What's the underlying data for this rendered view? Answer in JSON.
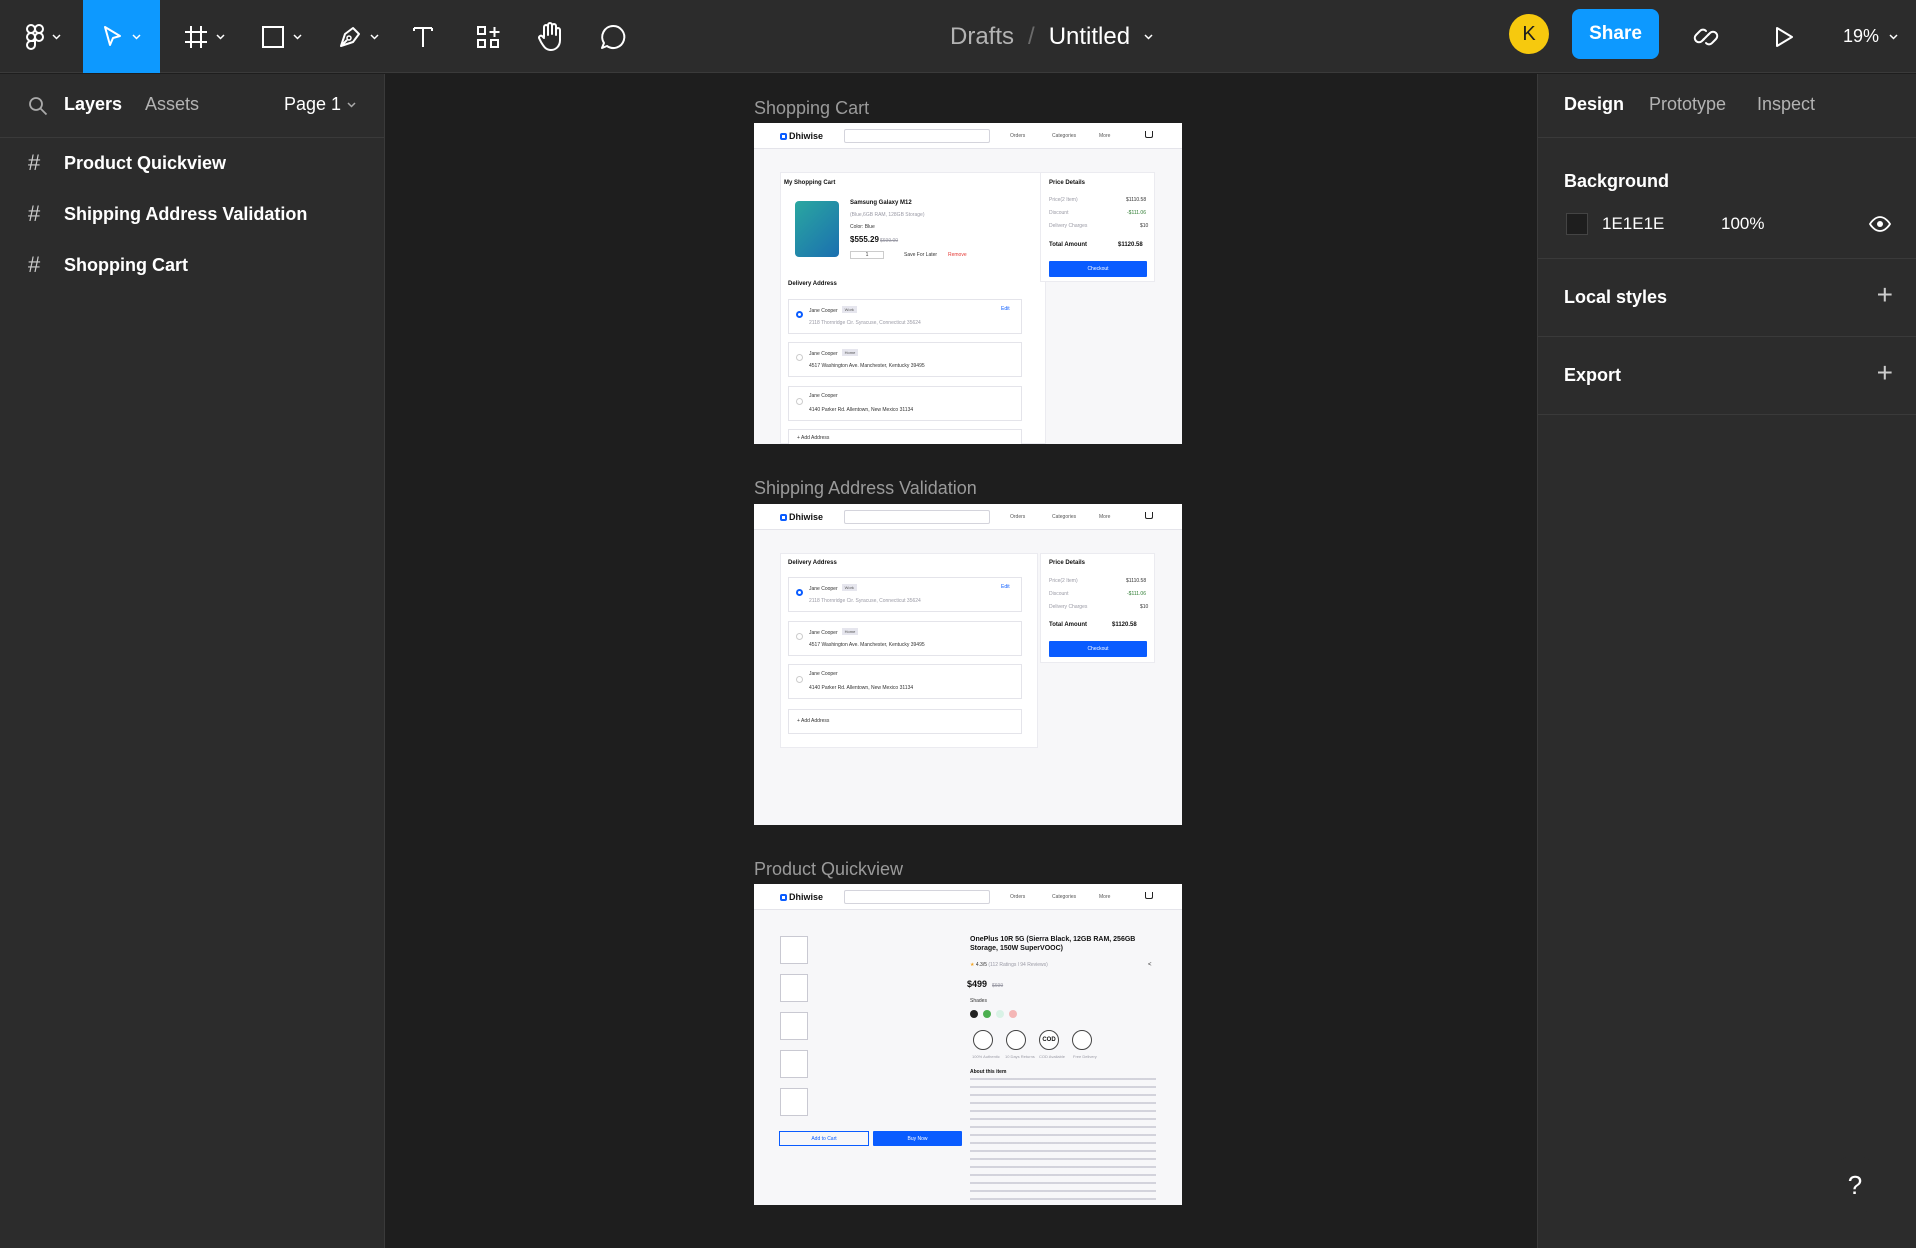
{
  "toolbar": {
    "main_menu_icon": "figma-logo-icon",
    "move_tool": "cursor-icon",
    "frame_tool": "frame-icon",
    "shape_tool": "rectangle-icon",
    "pen_tool": "pen-icon",
    "text_tool": "text-icon",
    "resources_tool": "components-icon",
    "hand_tool": "hand-icon",
    "comment_tool": "comment-icon"
  },
  "file": {
    "project": "Drafts",
    "separator": "/",
    "name": "Untitled"
  },
  "user": {
    "avatar_initial": "K",
    "avatar_color": "#f6c90e"
  },
  "share_label": "Share",
  "zoom_label": "19%",
  "left_panel": {
    "tabs": [
      "Layers",
      "Assets"
    ],
    "page_selector": "Page 1",
    "layers": [
      {
        "name": "Product Quickview"
      },
      {
        "name": "Shipping Address Validation"
      },
      {
        "name": "Shopping Cart"
      }
    ]
  },
  "right_panel": {
    "tabs": [
      "Design",
      "Prototype",
      "Inspect"
    ],
    "background": {
      "title": "Background",
      "hex": "1E1E1E",
      "opacity": "100%"
    },
    "local_styles": "Local styles",
    "export": "Export"
  },
  "colors": {
    "accent": "#0d99ff",
    "panel": "#2c2c2c",
    "canvas": "#1e1e1e",
    "mock_primary": "#0a5cff"
  },
  "frames": [
    {
      "label": "Shopping Cart",
      "brand": "Dhiwise",
      "nav": [
        "Orders",
        "Categories",
        "More"
      ],
      "cart_title": "My Shopping Cart",
      "product_name": "Samsung Galaxy M12",
      "product_variant": "(Blue,6GB RAM, 128GB Storage)",
      "product_color": "Color: Blue",
      "price": "$555.29",
      "old_price": "$699.00",
      "qty": "1",
      "save_for_later": "Save For Later",
      "remove": "Remove",
      "delivery_title": "Delivery Address",
      "addresses": [
        {
          "name": "Jane Cooper",
          "tag": "Work",
          "line": "2118 Thornridge Cir. Syracuse, Connecticut 35624",
          "edit": "Edit"
        },
        {
          "name": "Jane Cooper",
          "tag": "Home",
          "line": "4517 Washington Ave. Manchester, Kentucky 39495"
        },
        {
          "name": "Jane Cooper",
          "line": "4140 Parker Rd. Allentown, New Mexico 31134"
        }
      ],
      "add_address": "Add Address",
      "price_details": "Price Details",
      "price_rows": [
        {
          "label": "Price(2 Item)",
          "value": "$1110.58"
        },
        {
          "label": "Discount",
          "value": "-$111.06"
        },
        {
          "label": "Delivery Charges",
          "value": "$10"
        }
      ],
      "total_label": "Total Amount",
      "total_value": "$1120.58",
      "checkout": "Checkout"
    },
    {
      "label": "Shipping Address Validation",
      "brand": "Dhiwise",
      "nav": [
        "Orders",
        "Categories",
        "More"
      ],
      "delivery_title": "Delivery Address",
      "addresses": [
        {
          "name": "Jane Cooper",
          "tag": "Work",
          "line": "2118 Thornridge Cir. Syracuse, Connecticut 35624",
          "edit": "Edit"
        },
        {
          "name": "Jane Cooper",
          "tag": "Home",
          "line": "4517 Washington Ave. Manchester, Kentucky 39495"
        },
        {
          "name": "Jane Cooper",
          "line": "4140 Parker Rd. Allentown, New Mexico 31134"
        }
      ],
      "add_address": "Add Address",
      "price_details": "Price Details",
      "price_rows": [
        {
          "label": "Price(2 Item)",
          "value": "$1110.58"
        },
        {
          "label": "Discount",
          "value": "-$111.06"
        },
        {
          "label": "Delivery Charges",
          "value": "$10"
        }
      ],
      "total_label": "Total Amount",
      "total_value": "$1120.58",
      "checkout": "Checkout"
    },
    {
      "label": "Product Quickview",
      "brand": "Dhiwise",
      "nav": [
        "Orders",
        "Categories",
        "More"
      ],
      "product_title_1": "OnePlus 10R 5G (Sierra Black, 12GB RAM, 256GB",
      "product_title_2": "Storage, 150W SuperVOOC)",
      "rating": "4.3/5",
      "rating_meta": "(112 Ratings l 94 Reviews)",
      "price": "$499",
      "old_price": "$699",
      "shades": "Shades",
      "swatches": [
        "#222222",
        "#4caf50",
        "#d9f2e6",
        "#f4b6b6"
      ],
      "features": [
        "100% Authentic",
        "10 Days Returns",
        "COD Available",
        "Free Delivery"
      ],
      "cod": "COD",
      "about": "About this item",
      "add_to_cart": "Add to Cart",
      "buy_now": "Buy Now"
    }
  ]
}
